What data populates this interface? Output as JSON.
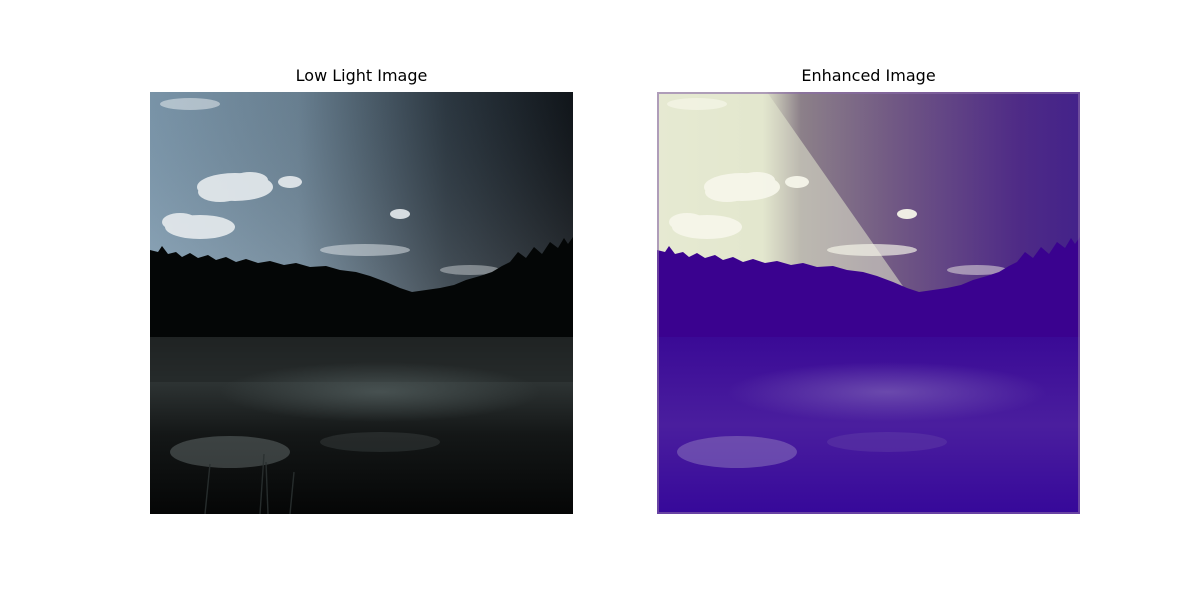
{
  "figure": {
    "panels": [
      {
        "title": "Low Light Image"
      },
      {
        "title": "Enhanced Image"
      }
    ]
  }
}
